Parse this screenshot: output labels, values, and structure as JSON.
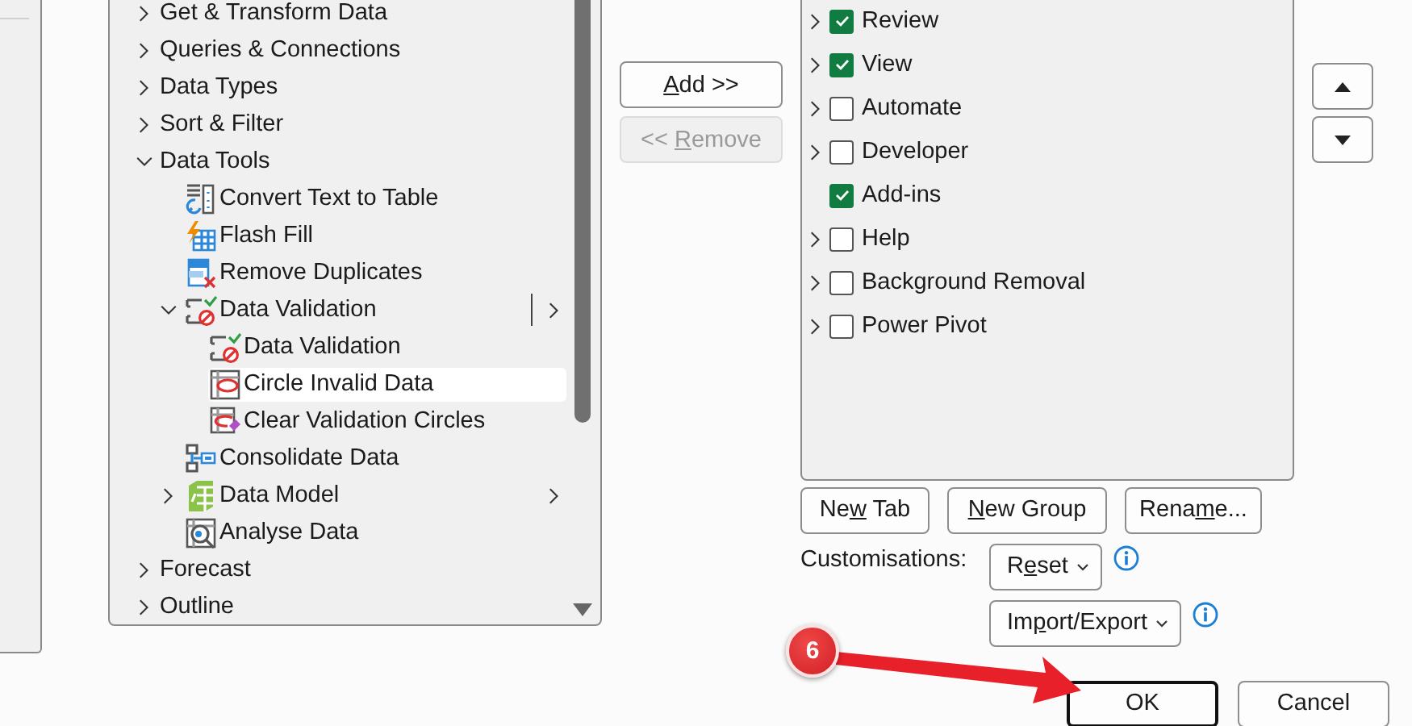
{
  "tree": {
    "items": [
      {
        "label": "Get & Transform Data",
        "expanded": false,
        "selected": false
      },
      {
        "label": "Queries & Connections",
        "expanded": false,
        "selected": false
      },
      {
        "label": "Data Types",
        "expanded": false,
        "selected": false
      },
      {
        "label": "Sort & Filter",
        "expanded": false,
        "selected": false
      },
      {
        "label": "Data Tools",
        "expanded": true,
        "selected": false,
        "children": [
          {
            "label": "Convert Text to Table",
            "selected": false
          },
          {
            "label": "Flash Fill",
            "selected": false
          },
          {
            "label": "Remove Duplicates",
            "selected": false
          },
          {
            "label": "Data Validation",
            "expanded": true,
            "selected": false,
            "submenu": true,
            "divider": true,
            "children": [
              {
                "label": "Data Validation",
                "selected": false
              },
              {
                "label": "Circle Invalid Data",
                "selected": true
              },
              {
                "label": "Clear Validation Circles",
                "selected": false
              }
            ]
          },
          {
            "label": "Consolidate Data",
            "selected": false
          },
          {
            "label": "Data Model",
            "expanded": false,
            "selected": false,
            "submenu": true
          },
          {
            "label": "Analyse Data",
            "selected": false
          }
        ]
      },
      {
        "label": "Forecast",
        "expanded": false,
        "selected": false
      },
      {
        "label": "Outline",
        "expanded": false,
        "selected": false
      }
    ]
  },
  "transfer_buttons": [
    {
      "key": "A",
      "post": "dd >>",
      "disabled": false
    },
    {
      "pre": "<< ",
      "key": "R",
      "post": "emove",
      "disabled": true
    }
  ],
  "ribbon_tabs": [
    {
      "label": "Review",
      "expanded": false,
      "checked": true
    },
    {
      "label": "View",
      "expanded": false,
      "checked": true
    },
    {
      "label": "Automate",
      "expanded": false,
      "checked": false
    },
    {
      "label": "Developer",
      "expanded": false,
      "checked": false
    },
    {
      "label": "Add-ins",
      "checked": true
    },
    {
      "label": "Help",
      "expanded": false,
      "checked": false
    },
    {
      "label": "Background Removal",
      "expanded": false,
      "checked": false
    },
    {
      "label": "Power Pivot",
      "expanded": false,
      "checked": false
    }
  ],
  "tab_buttons": [
    {
      "pre": "Ne",
      "key": "w",
      "post": " Tab"
    },
    {
      "key": "N",
      "post": "ew Group"
    },
    {
      "pre": "Rena",
      "key": "m",
      "post": "e..."
    }
  ],
  "customisations": {
    "label": "Customisations:",
    "buttons": [
      {
        "pre": "R",
        "key": "e",
        "post": "set"
      },
      {
        "pre": "Im",
        "key": "p",
        "post": "ort/Export"
      }
    ]
  },
  "dialog_buttons": [
    {
      "label": "OK",
      "default": true
    },
    {
      "label": "Cancel",
      "default": false
    }
  ],
  "annotation": {
    "step": "6"
  }
}
